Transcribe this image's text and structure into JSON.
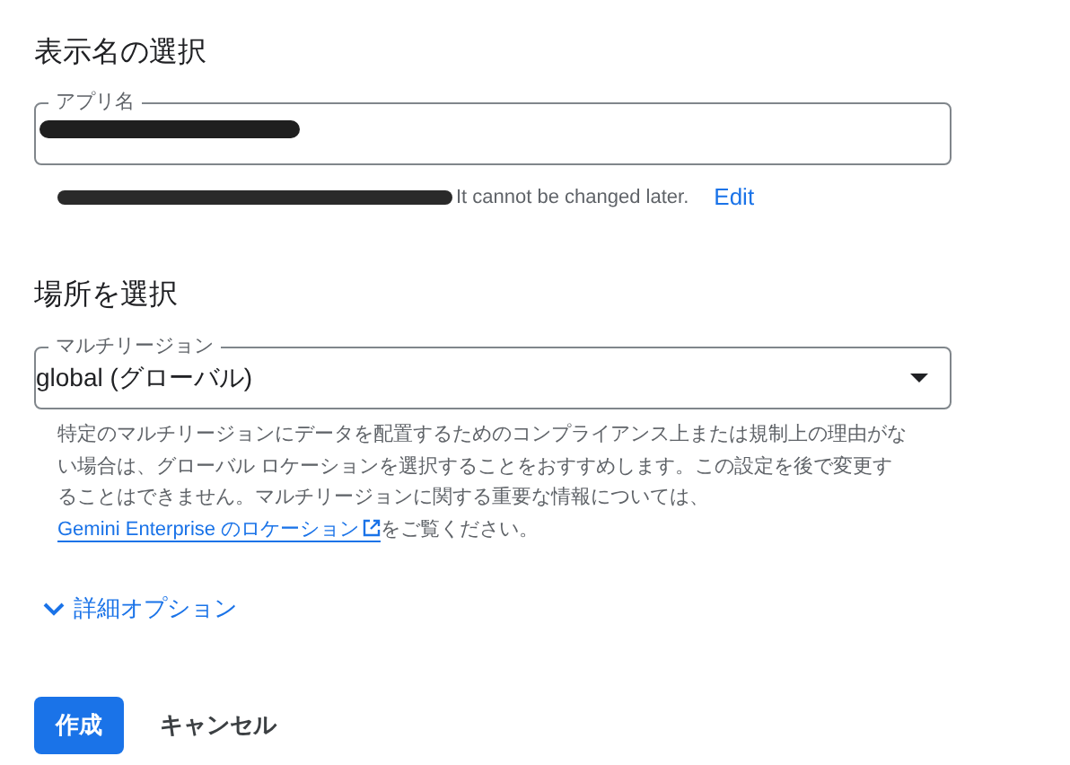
{
  "display_name_section": {
    "heading": "表示名の選択",
    "app_name_field": {
      "label": "アプリ名",
      "value_redacted": true
    },
    "id_hint": {
      "text": "It cannot be changed later.",
      "edit_link": "Edit"
    }
  },
  "location_section": {
    "heading": "場所を選択",
    "region_select": {
      "label": "マルチリージョン",
      "value": "global (グローバル)"
    },
    "help": {
      "before": "特定のマルチリージョンにデータを配置するためのコンプライアンス上または規制上の理由がない場合は、グローバル ロケーションを選択することをおすすめします。この設定を後で変更することはできません。マルチリージョンに関する重要な情報については、",
      "link": "Gemini Enterprise のロケーション",
      "after": "をご覧ください。"
    }
  },
  "advanced_options": {
    "label": "詳細オプション",
    "expanded": false
  },
  "buttons": [
    {
      "kind": "primary",
      "label": "作成"
    },
    {
      "kind": "text",
      "label": "キャンセル"
    }
  ]
}
